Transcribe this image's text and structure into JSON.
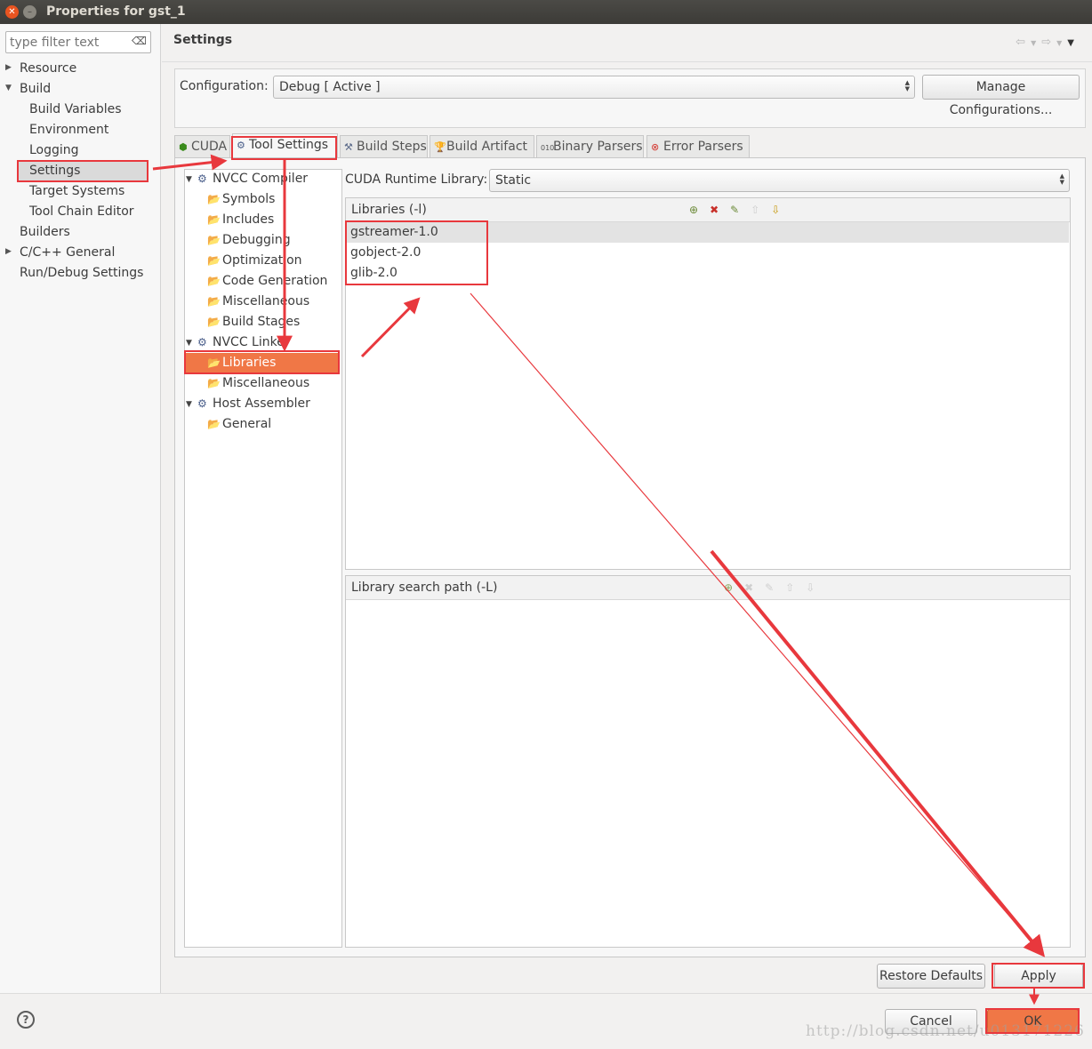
{
  "window": {
    "title": "Properties for gst_1"
  },
  "filter": {
    "placeholder": "type filter text"
  },
  "nav": [
    {
      "label": "Resource",
      "arrow": true
    },
    {
      "label": "Build",
      "arrow": true,
      "expanded": true
    },
    {
      "label": "Build Variables"
    },
    {
      "label": "Environment"
    },
    {
      "label": "Logging"
    },
    {
      "label": "Settings",
      "selected": true
    },
    {
      "label": "Target Systems"
    },
    {
      "label": "Tool Chain Editor"
    },
    {
      "label": "Builders"
    },
    {
      "label": "C/C++ General",
      "arrow": true
    },
    {
      "label": "Run/Debug Settings"
    }
  ],
  "page": {
    "title": "Settings"
  },
  "configuration": {
    "label": "Configuration:",
    "value": "Debug  [ Active ]",
    "manage_button": "Manage Configurations..."
  },
  "tabs": [
    {
      "label": "CUDA",
      "icon": "cuda-icon"
    },
    {
      "label": "Tool Settings",
      "icon": "tool-settings-icon",
      "active": true
    },
    {
      "label": "Build Steps",
      "icon": "build-steps-icon"
    },
    {
      "label": "Build Artifact",
      "icon": "build-artifact-icon"
    },
    {
      "label": "Binary Parsers",
      "icon": "binary-parsers-icon"
    },
    {
      "label": "Error Parsers",
      "icon": "error-parsers-icon"
    }
  ],
  "tool_tree": [
    {
      "label": "NVCC Compiler",
      "level": 0
    },
    {
      "label": "Symbols",
      "level": 1
    },
    {
      "label": "Includes",
      "level": 1
    },
    {
      "label": "Debugging",
      "level": 1
    },
    {
      "label": "Optimization",
      "level": 1
    },
    {
      "label": "Code Generation",
      "level": 1
    },
    {
      "label": "Miscellaneous",
      "level": 1
    },
    {
      "label": "Build Stages",
      "level": 1
    },
    {
      "label": "NVCC Linker",
      "level": 0
    },
    {
      "label": "Libraries",
      "level": 1,
      "selected": true
    },
    {
      "label": "Miscellaneous",
      "level": 1
    },
    {
      "label": "Host Assembler",
      "level": 0
    },
    {
      "label": "General",
      "level": 1
    }
  ],
  "runtime": {
    "label": "CUDA Runtime Library:",
    "value": "Static"
  },
  "libraries": {
    "title": "Libraries (-l)",
    "items": [
      "gstreamer-1.0",
      "gobject-2.0",
      "glib-2.0"
    ]
  },
  "library_search": {
    "title": "Library search path (-L)",
    "items": []
  },
  "buttons": {
    "restore_defaults": "Restore Defaults",
    "apply": "Apply",
    "cancel": "Cancel",
    "ok": "OK"
  },
  "watermark": "http://blog.csdn.net/u013171226",
  "colors": {
    "accent": "#f07746",
    "annotation": "#e8383d"
  }
}
